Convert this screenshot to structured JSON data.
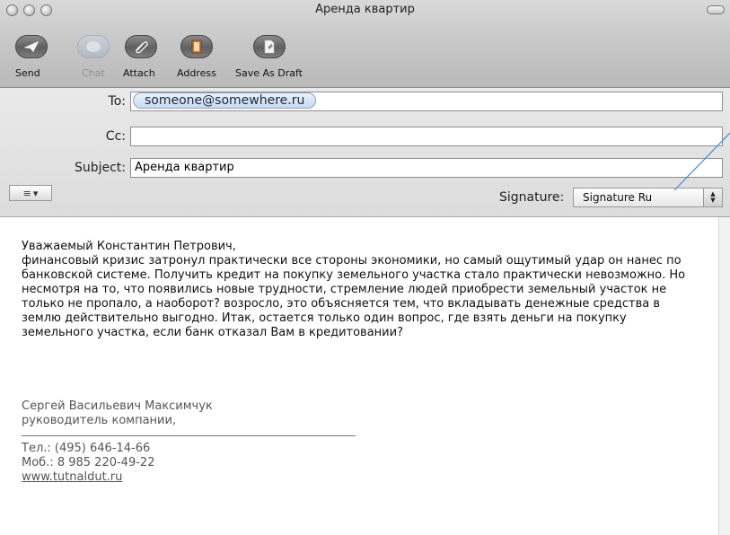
{
  "window": {
    "title": "Аренда квартир"
  },
  "toolbar": {
    "items": [
      {
        "label": "Send",
        "icon": "send-icon"
      },
      {
        "label": "Chat",
        "icon": "chat-icon"
      },
      {
        "label": "Attach",
        "icon": "paperclip-icon"
      },
      {
        "label": "Address",
        "icon": "address-book-icon"
      },
      {
        "label": "Save As Draft",
        "icon": "save-draft-icon"
      }
    ]
  },
  "headers": {
    "to_label": "To:",
    "to_value": "someone@somewhere.ru",
    "cc_label": "Cc:",
    "cc_value": "",
    "subject_label": "Subject:",
    "subject_value": "Аренда квартир",
    "signature_label": "Signature:",
    "signature_value": "Signature Ru"
  },
  "message": {
    "greeting": "Уважаемый Константин Петрович,",
    "lines": [
      "финансовый кризис затронул практически все стороны экономики, но самый ощутимый удар он нанес по",
      "банковской системе. Получить кредит на покупку земельного участка стало практически невозможно. Но",
      "несмотря на то, что появились новые трудности, стремление людей приобрести земельный участок не",
      "только не пропало, а наоборот? возросло, это объясняется тем, что вкладывать денежные средства в",
      "землю действительно выгодно. Итак, остается только один вопрос, где взять деньги на покупку",
      "земельного участка, если банк отказал Вам в кредитовании?"
    ]
  },
  "signature": {
    "name": "Сергей Васильевич Максимчук",
    "position": "руководитель компании,",
    "phone": "Тел.: (495) 646-14-66",
    "mobile": "Моб.: 8 985 220-49-22",
    "website": "www.tutnaldut.ru"
  },
  "colors": {
    "callout_line": "#3a8fd0",
    "token_bg": "#d8e5f5"
  }
}
